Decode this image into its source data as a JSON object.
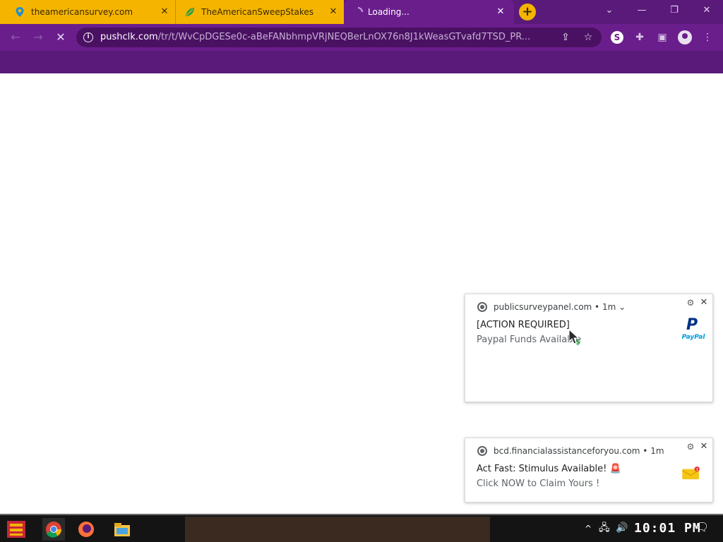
{
  "tabs": [
    {
      "title": "theamericansurvey.com",
      "icon": "location-pin-icon"
    },
    {
      "title": "TheAmericanSweepStakes",
      "icon": "leaf-icon"
    },
    {
      "title": "Loading...",
      "icon": "loading-spinner-icon"
    }
  ],
  "toolbar": {
    "url_host": "pushclk.com",
    "url_path": "/tr/t/WvCpDGESe0c-aBeFANbhmpVRjNEQBerLnOX76n8J1kWeasGTvafd7TSD_PR..."
  },
  "notifications": [
    {
      "source": "publicsurveypanel.com",
      "time": "• 1m",
      "title": "[ACTION REQUIRED]",
      "body": "Paypal Funds Available",
      "image": "paypal-logo",
      "logo_text": "PayPal"
    },
    {
      "source": "bcd.financialassistanceforyou.com",
      "time": "• 1m",
      "title": "Act Fast: Stimulus Available! 🚨",
      "body": "Click NOW to Claim Yours !",
      "image": "envelope-icon",
      "badge_count": "1"
    }
  ],
  "taskbar": {
    "clock": "10:01 PM"
  },
  "colors": {
    "browser_theme": "#6a1e8c",
    "tab_inactive": "#f4b400",
    "page_band": "#5a1a7a"
  }
}
